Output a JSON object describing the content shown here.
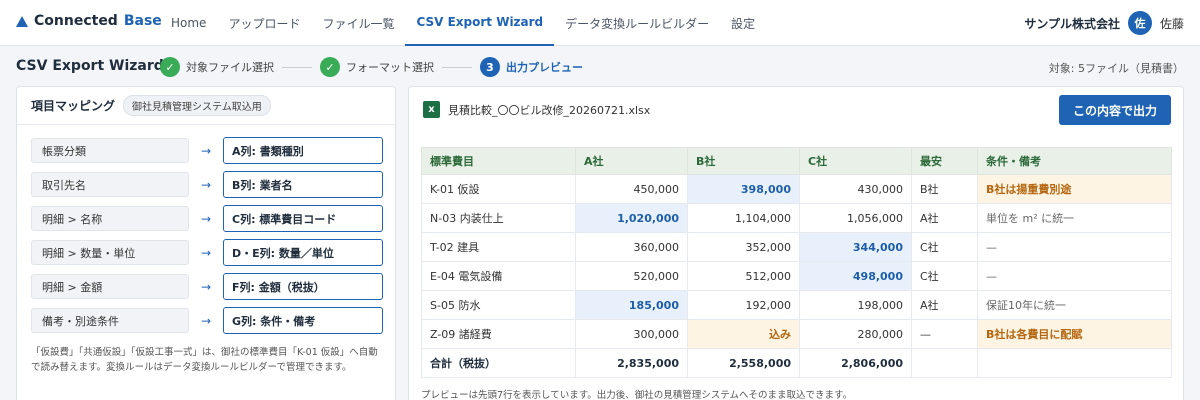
{
  "app": {
    "logo_main": "Connected",
    "logo_accent": "Base"
  },
  "nav": {
    "items": [
      {
        "label": "Home",
        "active": false
      },
      {
        "label": "アップロード",
        "active": false
      },
      {
        "label": "ファイル一覧",
        "active": false
      },
      {
        "label": "CSV Export Wizard",
        "active": true
      },
      {
        "label": "データ変換ルールビルダー",
        "active": false
      },
      {
        "label": "設定",
        "active": false
      }
    ],
    "company": "サンプル株式会社",
    "avatar_initial": "佐",
    "user_name": "佐藤"
  },
  "wizard": {
    "title": "CSV Export Wizard",
    "steps": [
      {
        "label": "対象ファイル選択",
        "marker": "✓",
        "state": "done"
      },
      {
        "label": "フォーマット選択",
        "marker": "✓",
        "state": "done"
      },
      {
        "label": "出力プレビュー",
        "marker": "3",
        "state": "current"
      }
    ],
    "target_info": "対象: 5ファイル（見積書）"
  },
  "mapping": {
    "title": "項目マッピング",
    "badge": "御社見積管理システム取込用",
    "arrow": "→",
    "rows": [
      {
        "source": "帳票分類",
        "target": "A列: 書類種別"
      },
      {
        "source": "取引先名",
        "target": "B列: 業者名"
      },
      {
        "source": "明細 > 名称",
        "target": "C列: 標準費目コード"
      },
      {
        "source": "明細 > 数量・単位",
        "target": "D・E列: 数量／単位"
      },
      {
        "source": "明細 > 金額",
        "target": "F列: 金額（税抜）"
      },
      {
        "source": "備考・別途条件",
        "target": "G列: 条件・備考"
      }
    ],
    "note": "「仮設費」「共通仮設」「仮設工事一式」は、御社の標準費目「K-01 仮設」へ自動で読み替えます。変換ルールはデータ変換ルールビルダーで管理できます。"
  },
  "preview": {
    "excel_icon": "x",
    "file_name": "見積比較_〇〇ビル改修_20260721.xlsx",
    "export_button": "この内容で出力",
    "columns": [
      "標準費目",
      "A社",
      "B社",
      "C社",
      "最安",
      "条件・備考"
    ],
    "rows": [
      {
        "item": "K-01 仮設",
        "a": "450,000",
        "b": "398,000",
        "c": "430,000",
        "lowest": "B社",
        "note": "B社は揚重費別途",
        "low_col": "b",
        "warn_col": "",
        "note_warn": true
      },
      {
        "item": "N-03 内装仕上",
        "a": "1,020,000",
        "b": "1,104,000",
        "c": "1,056,000",
        "lowest": "A社",
        "note": "単位を m² に統一",
        "low_col": "a",
        "warn_col": "",
        "note_warn": false
      },
      {
        "item": "T-02 建具",
        "a": "360,000",
        "b": "352,000",
        "c": "344,000",
        "lowest": "C社",
        "note": "—",
        "low_col": "c",
        "warn_col": "",
        "note_warn": false
      },
      {
        "item": "E-04 電気設備",
        "a": "520,000",
        "b": "512,000",
        "c": "498,000",
        "lowest": "C社",
        "note": "—",
        "low_col": "c",
        "warn_col": "",
        "note_warn": false
      },
      {
        "item": "S-05 防水",
        "a": "185,000",
        "b": "192,000",
        "c": "198,000",
        "lowest": "A社",
        "note": "保証10年に統一",
        "low_col": "a",
        "warn_col": "",
        "note_warn": false
      },
      {
        "item": "Z-09 諸経費",
        "a": "300,000",
        "b": "込み",
        "c": "280,000",
        "lowest": "—",
        "note": "B社は各費目に配賦",
        "low_col": "",
        "warn_col": "b",
        "note_warn": true
      }
    ],
    "total": {
      "item": "合計（税抜）",
      "a": "2,835,000",
      "b": "2,558,000",
      "c": "2,806,000",
      "lowest": "",
      "note": ""
    },
    "note": "プレビューは先頭7行を表示しています。出力後、御社の見積管理システムへそのまま取込できます。"
  }
}
